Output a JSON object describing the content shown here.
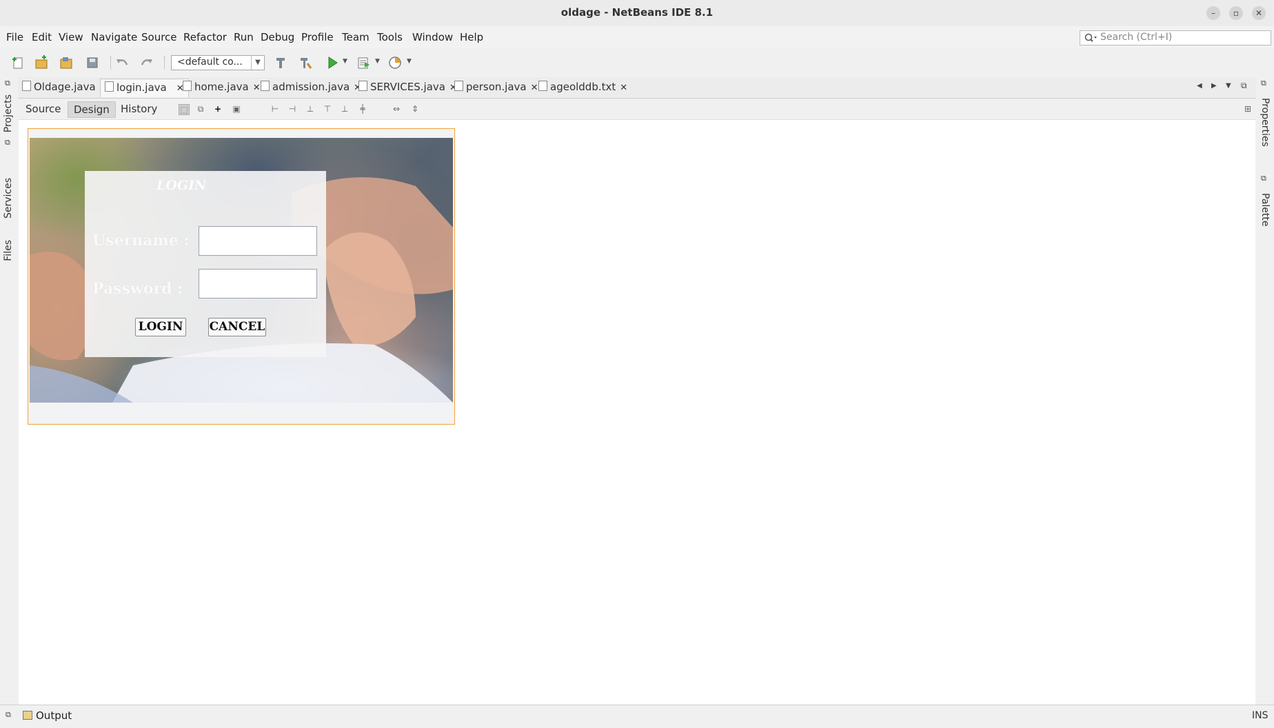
{
  "window": {
    "title": "oldage - NetBeans IDE 8.1"
  },
  "menu": [
    "File",
    "Edit",
    "View",
    "Navigate",
    "Source",
    "Refactor",
    "Run",
    "Debug",
    "Profile",
    "Team",
    "Tools",
    "Window",
    "Help"
  ],
  "search": {
    "placeholder": "Search (Ctrl+I)"
  },
  "toolbar": {
    "config": "<default co..."
  },
  "left_panels": {
    "projects": "Projects",
    "services": "Services",
    "files": "Files"
  },
  "right_panels": {
    "properties": "Properties",
    "palette": "Palette"
  },
  "tabs": [
    "Oldage.java",
    "login.java",
    "home.java",
    "admission.java",
    "SERVICES.java",
    "person.java",
    "ageolddb.txt"
  ],
  "editor_modes": {
    "source": "Source",
    "design": "Design",
    "history": "History"
  },
  "form": {
    "title": "LOGIN",
    "username_label": "Username :",
    "password_label": "Password :",
    "login_button": "LOGIN",
    "cancel_button": "CANCEL"
  },
  "bottom": {
    "output": "Output",
    "mode": "INS"
  }
}
